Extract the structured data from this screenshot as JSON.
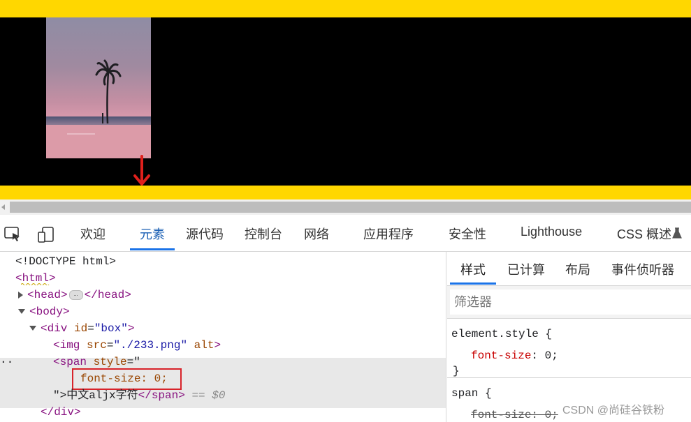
{
  "devtools": {
    "tabs": [
      {
        "label": "欢迎"
      },
      {
        "label": "元素"
      },
      {
        "label": "源代码"
      },
      {
        "label": "控制台"
      },
      {
        "label": "网络"
      },
      {
        "label": "应用程序"
      },
      {
        "label": "安全性"
      },
      {
        "label": "Lighthouse"
      },
      {
        "label": "CSS 概述"
      }
    ],
    "active_tab": "元素"
  },
  "dom": {
    "doctype": "<!DOCTYPE html>",
    "html_open": "<html>",
    "head_open": "<head>",
    "head_ellipsis": "…",
    "head_close": "</head>",
    "body_open": "<body>",
    "div_open_tag": "<div",
    "div_attr_name": "id",
    "div_attr_value": "\"box\"",
    "div_close_bracket": ">",
    "img_tag": "<img",
    "img_src_name": "src",
    "img_src_value": "\"./233.png\"",
    "img_alt": "alt",
    "img_close": ">",
    "span_tag": "<span",
    "span_style_name": "style",
    "span_style_open": "=\"",
    "span_style_value": "font-size: 0;",
    "span_close_quote": "\">",
    "span_text": "中文aljx字符",
    "span_close_tag": "</span>",
    "selected_marker": "== $0",
    "row_dots": "··",
    "div_close": "</div>"
  },
  "styles": {
    "subtabs": [
      {
        "label": "样式"
      },
      {
        "label": "已计算"
      },
      {
        "label": "布局"
      },
      {
        "label": "事件侦听器"
      }
    ],
    "filter_placeholder": "筛选器",
    "rule1_selector": "element.style {",
    "rule1_prop": "font-size",
    "rule1_value": ": 0;",
    "rule1_close": "}",
    "rule2_selector": "span {",
    "rule2_prop": "font-size: 0;"
  },
  "watermark": "CSDN @尚硅谷铁粉",
  "colors": {
    "page_bg": "#ffd700",
    "box_bg": "#000000",
    "accent": "#1a73e8",
    "highlight_border": "#d8232a"
  }
}
